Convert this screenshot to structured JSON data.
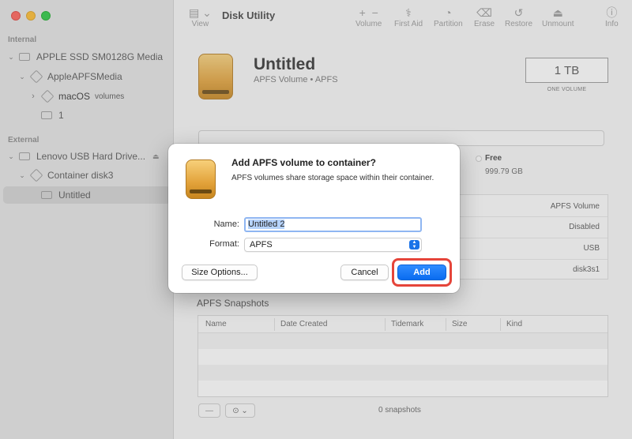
{
  "window": {
    "title": "Disk Utility"
  },
  "sidebar": {
    "section_internal": "Internal",
    "section_external": "External",
    "items": [
      {
        "label": "APPLE SSD SM0128G Media"
      },
      {
        "label": "AppleAPFSMedia"
      },
      {
        "label": "macOS",
        "note": "volumes"
      },
      {
        "label": "1"
      },
      {
        "label": "Lenovo USB Hard Drive..."
      },
      {
        "label": "Container disk3"
      },
      {
        "label": "Untitled"
      }
    ]
  },
  "toolbar": {
    "view": "View",
    "volume": "Volume",
    "first_aid": "First Aid",
    "partition": "Partition",
    "erase": "Erase",
    "restore": "Restore",
    "unmount": "Unmount",
    "info": "Info"
  },
  "volume": {
    "name": "Untitled",
    "subtitle": "APFS Volume • APFS",
    "capacity": "1 TB",
    "capacity_label": "ONE VOLUME",
    "free_label": "Free",
    "free_value": "999.79 GB"
  },
  "info": [
    "APFS Volume",
    "Disabled",
    "USB",
    "disk3s1"
  ],
  "snapshots": {
    "title": "APFS Snapshots",
    "columns": [
      "Name",
      "Date Created",
      "Tidemark",
      "Size",
      "Kind"
    ],
    "count": "0 snapshots"
  },
  "dialog": {
    "title": "Add APFS volume to container?",
    "message": "APFS volumes share storage space within their container.",
    "name_label": "Name:",
    "name_value": "Untitled 2",
    "format_label": "Format:",
    "format_value": "APFS",
    "size_options": "Size Options...",
    "cancel": "Cancel",
    "add": "Add"
  },
  "colors": {
    "accent": "#0a6cf0",
    "highlight": "#e5453a"
  }
}
